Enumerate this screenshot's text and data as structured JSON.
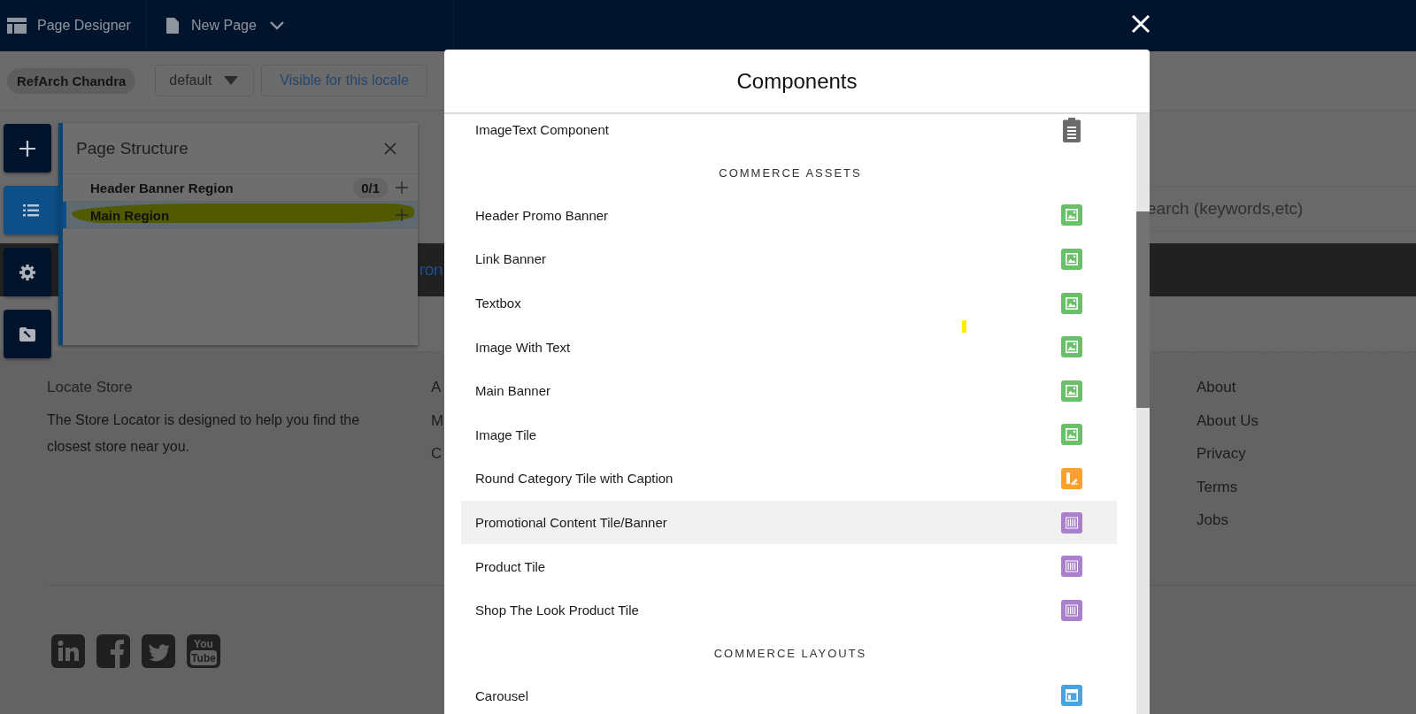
{
  "header": {
    "app_title": "Page Designer",
    "page_name": "New Page"
  },
  "toolbar": {
    "user": "RefArch Chandra",
    "locale": "default",
    "visibility": "Visible for this locale"
  },
  "tool_rail": [
    {
      "kind": "add",
      "selected": false
    },
    {
      "kind": "list",
      "selected": true
    },
    {
      "kind": "settings",
      "selected": false
    },
    {
      "kind": "folder",
      "selected": false
    }
  ],
  "page_structure": {
    "title": "Page Structure",
    "regions": [
      {
        "name": "Header Banner Region",
        "count": "0/1",
        "selected": false,
        "highlighted": false
      },
      {
        "name": "Main Region",
        "selected": true,
        "highlighted": true
      }
    ]
  },
  "preview": {
    "search_placeholder": "earch (keywords,etc)",
    "banner_link": "ron",
    "footer": {
      "heading": "Locate Store",
      "text": "The Store Locator is designed to help you find the closest store near you.",
      "column_2": [
        "A",
        "M",
        "C"
      ],
      "column_3": [
        "About",
        "About Us",
        "Privacy",
        "Terms",
        "Jobs"
      ],
      "social": [
        {
          "kind": "linkedin"
        },
        {
          "kind": "facebook"
        },
        {
          "kind": "twitter"
        },
        {
          "kind": "youtube",
          "text": [
            "You",
            "Tube"
          ]
        }
      ]
    }
  },
  "modal": {
    "title": "Components",
    "sections": [
      {
        "items": [
          {
            "label": "ImageText Component",
            "kind": "clipboard",
            "color": "#6b6b6b",
            "selected": false
          }
        ]
      },
      {
        "heading": "COMMERCE ASSETS",
        "items": [
          {
            "label": "Header Promo Banner",
            "kind": "image",
            "color": "#6abf69",
            "selected": false
          },
          {
            "label": "Link Banner",
            "kind": "image",
            "color": "#6abf69",
            "selected": false
          },
          {
            "label": "Textbox",
            "kind": "image",
            "color": "#6abf69",
            "selected": false
          },
          {
            "label": "Image With Text",
            "kind": "image",
            "color": "#6abf69",
            "selected": false
          },
          {
            "label": "Main Banner",
            "kind": "image",
            "color": "#6abf69",
            "selected": false
          },
          {
            "label": "Image Tile",
            "kind": "image",
            "color": "#6abf69",
            "selected": false
          },
          {
            "label": "Round Category Tile with Caption",
            "kind": "swatch",
            "color": "#ff9f2e",
            "selected": false
          },
          {
            "label": "Promotional Content Tile/Banner",
            "kind": "bars",
            "color": "#a97fce",
            "selected": true
          },
          {
            "label": "Product Tile",
            "kind": "bars",
            "color": "#a97fce",
            "selected": false
          },
          {
            "label": "Shop The Look Product Tile",
            "kind": "bars",
            "color": "#a97fce",
            "selected": false
          }
        ]
      },
      {
        "heading": "COMMERCE LAYOUTS",
        "items": [
          {
            "label": "Carousel",
            "kind": "layout",
            "color": "#4aa3df",
            "selected": false
          }
        ]
      }
    ]
  }
}
